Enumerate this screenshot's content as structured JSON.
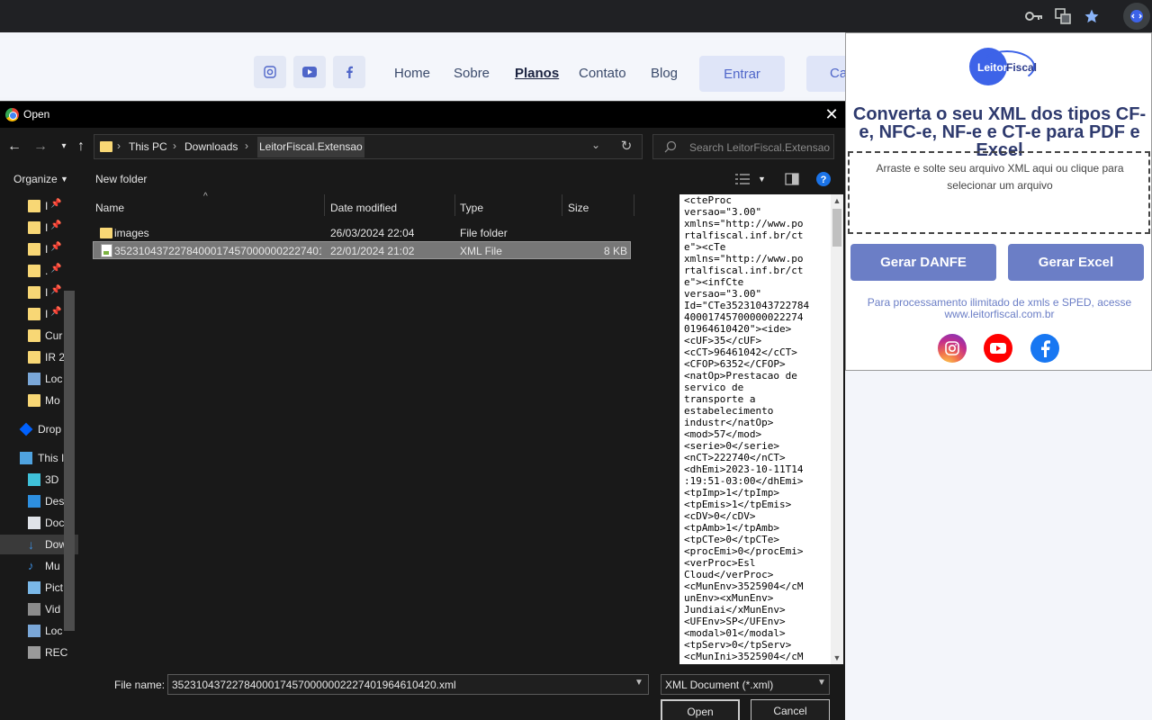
{
  "browser": {
    "icons": [
      "key-icon",
      "translate-icon",
      "star-icon",
      "extension-icon"
    ]
  },
  "site": {
    "nav": [
      "Home",
      "Sobre",
      "Planos",
      "Contato",
      "Blog"
    ],
    "entrar": "Entrar",
    "cadastro_partial": "Ca"
  },
  "dialog": {
    "title": "Open",
    "breadcrumb": [
      "This PC",
      "Downloads",
      "LeitorFiscal.Extensao"
    ],
    "search_placeholder": "Search LeitorFiscal.Extensao",
    "organize": "Organize",
    "new_folder": "New folder",
    "columns": {
      "name": "Name",
      "date": "Date modified",
      "type": "Type",
      "size": "Size"
    },
    "files": [
      {
        "name": "images",
        "date": "26/03/2024 22:04",
        "type": "File folder",
        "size": ""
      },
      {
        "name": "35231043722784000174570000002227401964...",
        "date": "22/01/2024 21:02",
        "type": "XML File",
        "size": "8 KB"
      }
    ],
    "nav_items": [
      {
        "label": "I"
      },
      {
        "label": "I"
      },
      {
        "label": "I"
      },
      {
        "label": "."
      },
      {
        "label": "I"
      },
      {
        "label": "I"
      },
      {
        "label": "Cur"
      },
      {
        "label": "IR 2"
      },
      {
        "label": "Loc"
      },
      {
        "label": "Mo"
      },
      {
        "label": "Drop"
      },
      {
        "label": "This I"
      },
      {
        "label": "3D"
      },
      {
        "label": "Des"
      },
      {
        "label": "Doc"
      },
      {
        "label": "Dow"
      },
      {
        "label": "Mu"
      },
      {
        "label": "Pict"
      },
      {
        "label": "Vid"
      },
      {
        "label": "Loc"
      },
      {
        "label": "REC"
      }
    ],
    "preview_text": "<cteProc\nversao=\"3.00\"\nxmlns=\"http://www.po\nrtalfiscal.inf.br/ct\ne\"><cTe\nxmlns=\"http://www.po\nrtalfiscal.inf.br/ct\ne\"><infCte\nversao=\"3.00\"\nId=\"CTe35231043722784\n40001745700000022274\n01964610420\"><ide>\n<cUF>35</cUF>\n<cCT>96461042</cCT>\n<CFOP>6352</CFOP>\n<natOp>Prestacao de\nservico de\ntransporte a\nestabelecimento\nindustr</natOp>\n<mod>57</mod>\n<serie>0</serie>\n<nCT>222740</nCT>\n<dhEmi>2023-10-11T14\n:19:51-03:00</dhEmi>\n<tpImp>1</tpImp>\n<tpEmis>1</tpEmis>\n<cDV>0</cDV>\n<tpAmb>1</tpAmb>\n<tpCTe>0</tpCTe>\n<procEmi>0</procEmi>\n<verProc>Esl\nCloud</verProc>\n<cMunEnv>3525904</cM\nunEnv><xMunEnv>\nJundiai</xMunEnv>\n<UFEnv>SP</UFEnv>\n<modal>01</modal>\n<tpServ>0</tpServ>\n<cMunIni>3525904</cM",
    "file_name_label": "File name:",
    "file_name_value": "35231043722784000174570000002227401964610420.xml",
    "file_type": "XML Document (*.xml)",
    "open_label": "Open",
    "cancel_label": "Cancel"
  },
  "popup": {
    "logo_part1": "Leitor",
    "logo_part2": "Fiscal",
    "title": "Converta o seu XML dos tipos CF-e, NFC-e, NF-e e CT-e para PDF e Excel",
    "dropzone_text": "Arraste e solte seu arquivo XML aqui ou clique para selecionar um arquivo",
    "btn_danfe": "Gerar DANFE",
    "btn_excel": "Gerar Excel",
    "note": "Para processamento ilimitado de xmls e SPED, acesse www.leitorfiscal.com.br",
    "accent": "#6b7ec6"
  }
}
